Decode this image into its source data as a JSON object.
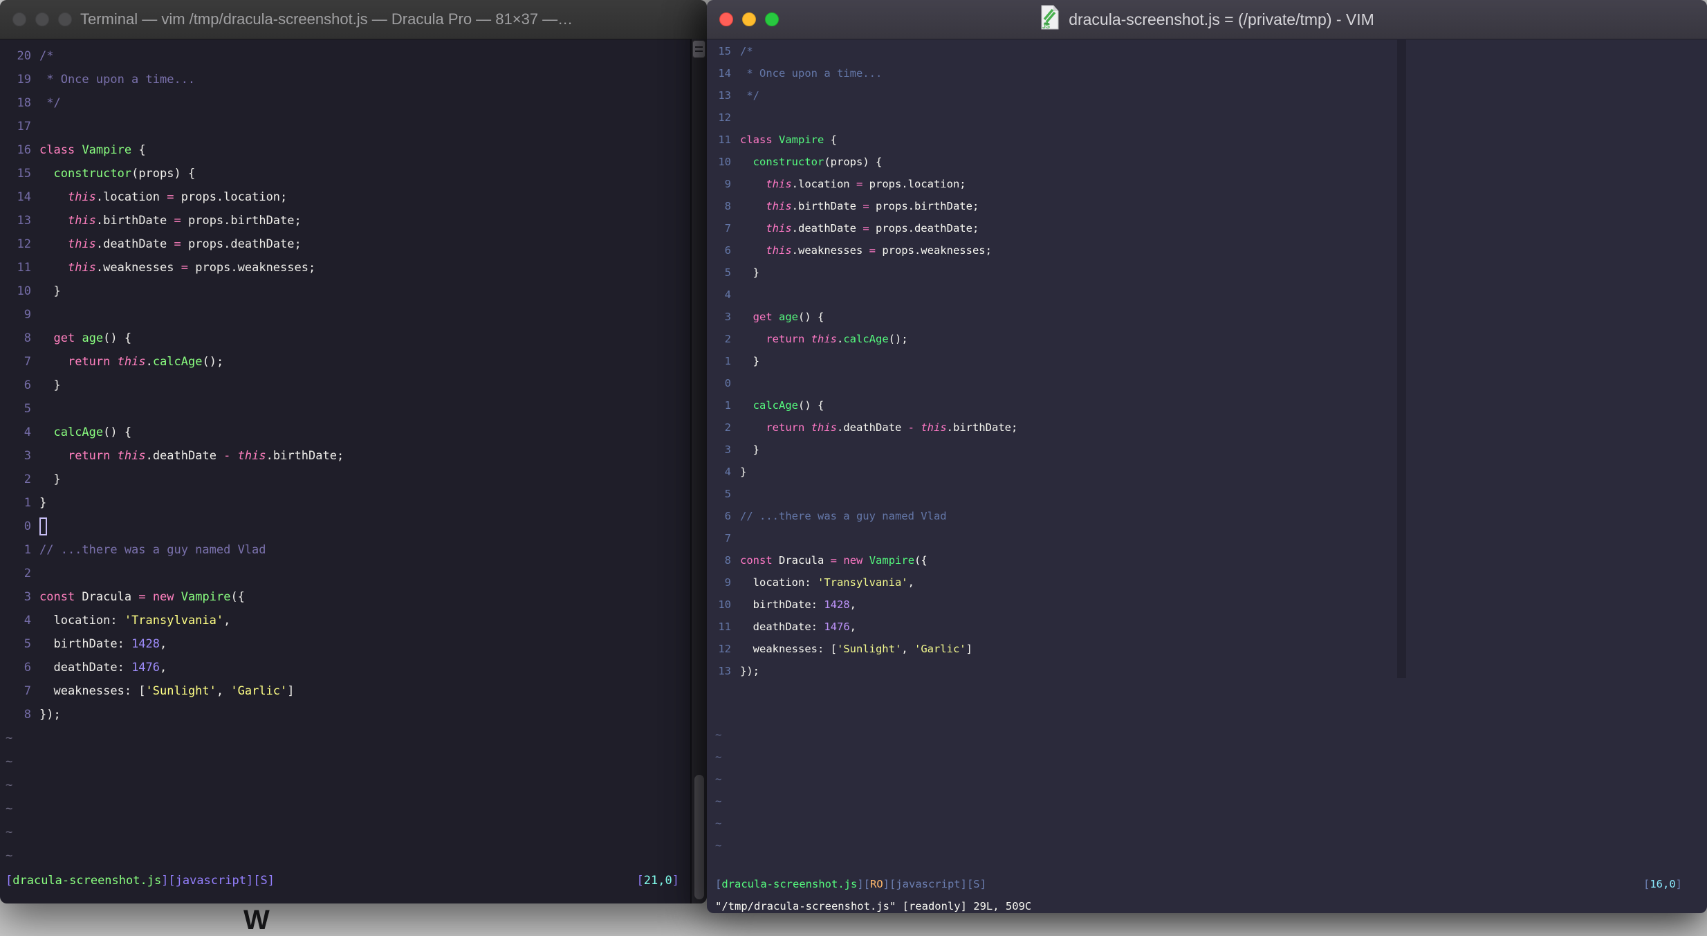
{
  "desktop": {
    "bg": "#CBCBCB",
    "peek_glyph": "W"
  },
  "left_window": {
    "title": "Terminal — vim /tmp/dracula-screenshot.js — Dracula Pro — 81×37 —…",
    "controls": [
      "close",
      "minimize",
      "zoom"
    ],
    "theme": {
      "background": "#1F1E29",
      "accent_pink": "#FF80BF",
      "accent_green": "#8AFF80",
      "accent_yellow": "#FFFF85",
      "accent_purple": "#9580FF",
      "accent_cyan": "#82FFEE",
      "comment": "#7A71AC"
    },
    "numbers": [
      "20",
      "19",
      "18",
      "17",
      "16",
      "15",
      "14",
      "13",
      "12",
      "11",
      "10",
      "9",
      "8",
      "7",
      "6",
      "5",
      "4",
      "3",
      "2",
      "1",
      "0",
      "1",
      "2",
      "3",
      "4",
      "5",
      "6",
      "7",
      "8"
    ],
    "cursor_line_index": 20,
    "cursor_style": "hollow",
    "tilde": "~",
    "tilde_count": 6,
    "statusline": [
      {
        "t": "[",
        "c": "br"
      },
      {
        "t": "dracula-screenshot.js",
        "c": "fn"
      },
      {
        "t": "][javascript][S]",
        "c": "br"
      }
    ],
    "ruler": [
      {
        "t": "[",
        "c": "br"
      },
      {
        "t": "21,0",
        "c": "cy"
      },
      {
        "t": "]",
        "c": "br"
      }
    ]
  },
  "right_window": {
    "title": "dracula-screenshot.js = (/private/tmp) - VIM",
    "file_icon": "js-document",
    "controls": [
      "close",
      "minimize",
      "zoom"
    ],
    "theme": {
      "background": "#2B2A3B",
      "accent_pink": "#FF79C6",
      "accent_green": "#55FA7E",
      "accent_yellow": "#F3F98E",
      "accent_purple": "#BD93F9",
      "accent_cyan": "#8BE9FD",
      "comment": "#6477A8",
      "readonly_orange": "#FFB86C"
    },
    "numbers": [
      "15",
      "14",
      "13",
      "12",
      "11",
      "10",
      "9",
      "8",
      "7",
      "6",
      "5",
      "4",
      "3",
      "2",
      "1",
      "0",
      "1",
      "2",
      "3",
      "4",
      "5",
      "6",
      "7",
      "8",
      "9",
      "10",
      "11",
      "12",
      "13"
    ],
    "cursor_line_index": 15,
    "cursor_style": "none",
    "tilde": "~",
    "tilde_count": 6,
    "statusline": [
      {
        "t": "[",
        "c": "br"
      },
      {
        "t": "dracula-screenshot.js",
        "c": "fn"
      },
      {
        "t": "][",
        "c": "br"
      },
      {
        "t": "RO",
        "c": "ro"
      },
      {
        "t": "][javascript][S]",
        "c": "br"
      }
    ],
    "ruler": [
      {
        "t": "[",
        "c": "br"
      },
      {
        "t": "16,0",
        "c": "cy"
      },
      {
        "t": "]",
        "c": "br"
      }
    ],
    "command_line": "\"/tmp/dracula-screenshot.js\" [readonly] 29L, 509C"
  },
  "code_lines": [
    [
      {
        "t": "/*",
        "c": "com"
      }
    ],
    [
      {
        "t": " * Once upon a time...",
        "c": "com"
      }
    ],
    [
      {
        "t": " */",
        "c": "com"
      }
    ],
    [],
    [
      {
        "t": "class",
        "c": "kw"
      },
      {
        "t": " ",
        "c": "fg"
      },
      {
        "t": "Vampire",
        "c": "fn"
      },
      {
        "t": " {",
        "c": "fg"
      }
    ],
    [
      {
        "t": "  ",
        "c": "fg"
      },
      {
        "t": "constructor",
        "c": "fn"
      },
      {
        "t": "(props) {",
        "c": "fg"
      }
    ],
    [
      {
        "t": "    ",
        "c": "fg"
      },
      {
        "t": "this",
        "c": "kwi"
      },
      {
        "t": ".location ",
        "c": "fg"
      },
      {
        "t": "=",
        "c": "kw"
      },
      {
        "t": " props.location;",
        "c": "fg"
      }
    ],
    [
      {
        "t": "    ",
        "c": "fg"
      },
      {
        "t": "this",
        "c": "kwi"
      },
      {
        "t": ".birthDate ",
        "c": "fg"
      },
      {
        "t": "=",
        "c": "kw"
      },
      {
        "t": " props.birthDate;",
        "c": "fg"
      }
    ],
    [
      {
        "t": "    ",
        "c": "fg"
      },
      {
        "t": "this",
        "c": "kwi"
      },
      {
        "t": ".deathDate ",
        "c": "fg"
      },
      {
        "t": "=",
        "c": "kw"
      },
      {
        "t": " props.deathDate;",
        "c": "fg"
      }
    ],
    [
      {
        "t": "    ",
        "c": "fg"
      },
      {
        "t": "this",
        "c": "kwi"
      },
      {
        "t": ".weaknesses ",
        "c": "fg"
      },
      {
        "t": "=",
        "c": "kw"
      },
      {
        "t": " props.weaknesses;",
        "c": "fg"
      }
    ],
    [
      {
        "t": "  }",
        "c": "fg"
      }
    ],
    [],
    [
      {
        "t": "  ",
        "c": "fg"
      },
      {
        "t": "get",
        "c": "kw"
      },
      {
        "t": " ",
        "c": "fg"
      },
      {
        "t": "age",
        "c": "fn"
      },
      {
        "t": "() {",
        "c": "fg"
      }
    ],
    [
      {
        "t": "    ",
        "c": "fg"
      },
      {
        "t": "return",
        "c": "kw"
      },
      {
        "t": " ",
        "c": "fg"
      },
      {
        "t": "this",
        "c": "kwi"
      },
      {
        "t": ".",
        "c": "fg"
      },
      {
        "t": "calcAge",
        "c": "fn"
      },
      {
        "t": "();",
        "c": "fg"
      }
    ],
    [
      {
        "t": "  }",
        "c": "fg"
      }
    ],
    [],
    [
      {
        "t": "  ",
        "c": "fg"
      },
      {
        "t": "calcAge",
        "c": "fn"
      },
      {
        "t": "() {",
        "c": "fg"
      }
    ],
    [
      {
        "t": "    ",
        "c": "fg"
      },
      {
        "t": "return",
        "c": "kw"
      },
      {
        "t": " ",
        "c": "fg"
      },
      {
        "t": "this",
        "c": "kwi"
      },
      {
        "t": ".deathDate ",
        "c": "fg"
      },
      {
        "t": "-",
        "c": "kw"
      },
      {
        "t": " ",
        "c": "fg"
      },
      {
        "t": "this",
        "c": "kwi"
      },
      {
        "t": ".birthDate;",
        "c": "fg"
      }
    ],
    [
      {
        "t": "  }",
        "c": "fg"
      }
    ],
    [
      {
        "t": "}",
        "c": "fg"
      }
    ],
    [],
    [
      {
        "t": "// ...there was a guy named Vlad",
        "c": "com"
      }
    ],
    [],
    [
      {
        "t": "const",
        "c": "kw"
      },
      {
        "t": " Dracula ",
        "c": "fg"
      },
      {
        "t": "=",
        "c": "kw"
      },
      {
        "t": " ",
        "c": "fg"
      },
      {
        "t": "new",
        "c": "kw"
      },
      {
        "t": " ",
        "c": "fg"
      },
      {
        "t": "Vampire",
        "c": "fn"
      },
      {
        "t": "({",
        "c": "fg"
      }
    ],
    [
      {
        "t": "  location: ",
        "c": "fg"
      },
      {
        "t": "'Transylvania'",
        "c": "str"
      },
      {
        "t": ",",
        "c": "fg"
      }
    ],
    [
      {
        "t": "  birthDate: ",
        "c": "fg"
      },
      {
        "t": "1428",
        "c": "num"
      },
      {
        "t": ",",
        "c": "fg"
      }
    ],
    [
      {
        "t": "  deathDate: ",
        "c": "fg"
      },
      {
        "t": "1476",
        "c": "num"
      },
      {
        "t": ",",
        "c": "fg"
      }
    ],
    [
      {
        "t": "  weaknesses: [",
        "c": "fg"
      },
      {
        "t": "'Sunlight'",
        "c": "str"
      },
      {
        "t": ", ",
        "c": "fg"
      },
      {
        "t": "'Garlic'",
        "c": "str"
      },
      {
        "t": "]",
        "c": "fg"
      }
    ],
    [
      {
        "t": "});",
        "c": "fg"
      }
    ]
  ]
}
